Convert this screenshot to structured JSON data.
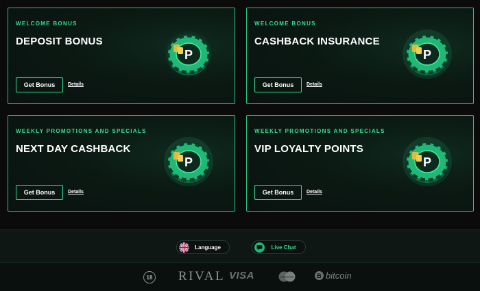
{
  "cards": [
    {
      "eyebrow": "WELCOME BONUS",
      "title": "DEPOSIT BONUS",
      "button": "Get Bonus",
      "link": "Details"
    },
    {
      "eyebrow": "WELCOME BONUS",
      "title": "CASHBACK INSURANCE",
      "button": "Get Bonus",
      "link": "Details"
    },
    {
      "eyebrow": "WEEKLY PROMOTIONS AND SPECIALS",
      "title": "NEXT DAY CASHBACK",
      "button": "Get Bonus",
      "link": "Details"
    },
    {
      "eyebrow": "WEEKLY PROMOTIONS AND SPECIALS",
      "title": "VIP LOYALTY POINTS",
      "button": "Get Bonus",
      "link": "Details"
    }
  ],
  "footer": {
    "language_label": "Language",
    "live_chat_label": "Live Chat",
    "age_badge": "18",
    "partners": {
      "rival": "RIVAL",
      "visa": "VISA",
      "mastercard": "MasterCard",
      "bitcoin": "bitcoin",
      "bitcoin_symbol": "B"
    }
  },
  "colors": {
    "accent": "#2fe08e",
    "border": "#23c57f",
    "background": "#0b0b0b"
  },
  "icons": [
    "poker-chip-icon",
    "uk-flag-icon",
    "chat-bubble-icon",
    "age-18-icon",
    "bitcoin-icon"
  ]
}
